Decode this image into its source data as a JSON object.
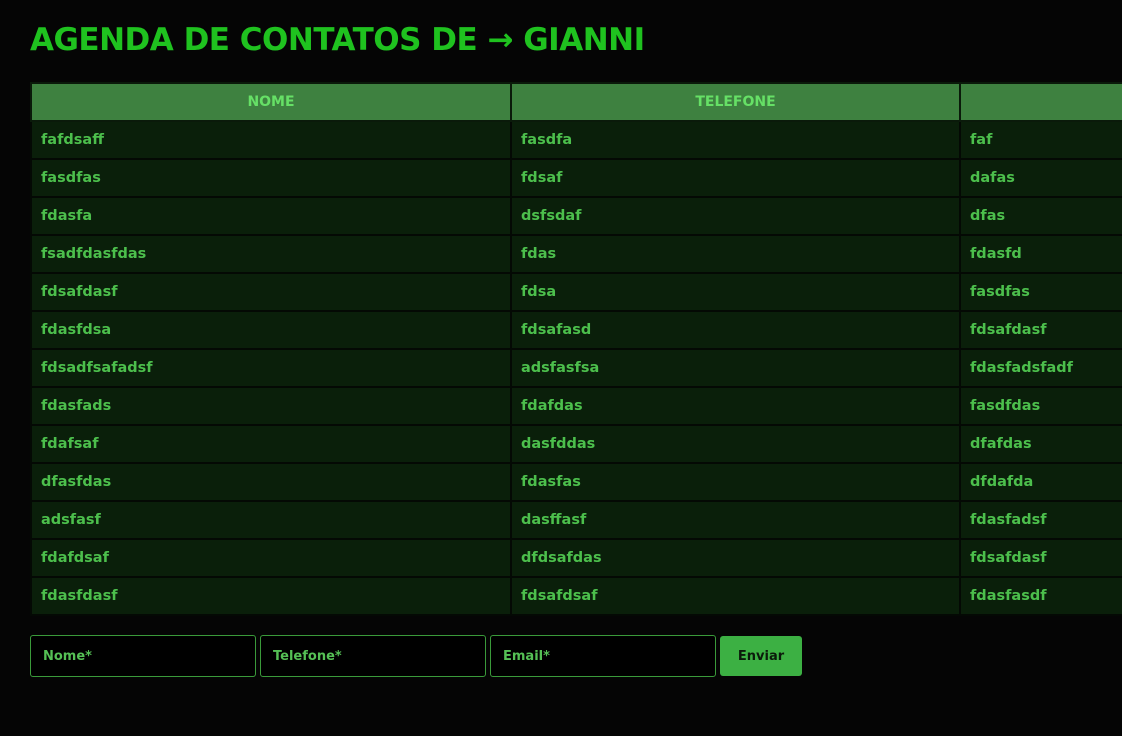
{
  "title": "AGENDA DE CONTATOS DE → GIANNI",
  "table": {
    "headers": [
      "NOME",
      "TELEFONE",
      ""
    ],
    "rows": [
      [
        "fafdsaff",
        "fasdfa",
        "faf"
      ],
      [
        "fasdfas",
        "fdsaf",
        "dafas"
      ],
      [
        "fdasfa",
        "dsfsdaf",
        "dfas"
      ],
      [
        "fsadfdasfdas",
        "fdas",
        "fdasfd"
      ],
      [
        "fdsafdasf",
        "fdsa",
        "fasdfas"
      ],
      [
        "fdasfdsa",
        "fdsafasd",
        "fdsafdasf"
      ],
      [
        "fdsadfsafadsf",
        "adsfasfsa",
        "fdasfadsfadf"
      ],
      [
        "fdasfads",
        "fdafdas",
        "fasdfdas"
      ],
      [
        "fdafsaf",
        "dasfddas",
        "dfafdas"
      ],
      [
        "dfasfdas",
        "fdasfas",
        "dfdafda"
      ],
      [
        "adsfasf",
        "dasffasf",
        "fdasfadsf"
      ],
      [
        "fdafdsaf",
        "dfdsafdas",
        "fdsafdasf"
      ],
      [
        "fdasfdasf",
        "fdsafdsaf",
        "fdasfasdf"
      ]
    ]
  },
  "form": {
    "nome_placeholder": "Nome*",
    "telefone_placeholder": "Telefone*",
    "email_placeholder": "Email*",
    "submit_label": "Enviar"
  },
  "colors": {
    "background": "#050505",
    "title": "#1fc21f",
    "header_bg": "#3e8140",
    "header_text": "#66e066",
    "row_bg": "#0a1f0a",
    "row_text": "#4cbf4c",
    "button_bg": "#3cb043"
  }
}
